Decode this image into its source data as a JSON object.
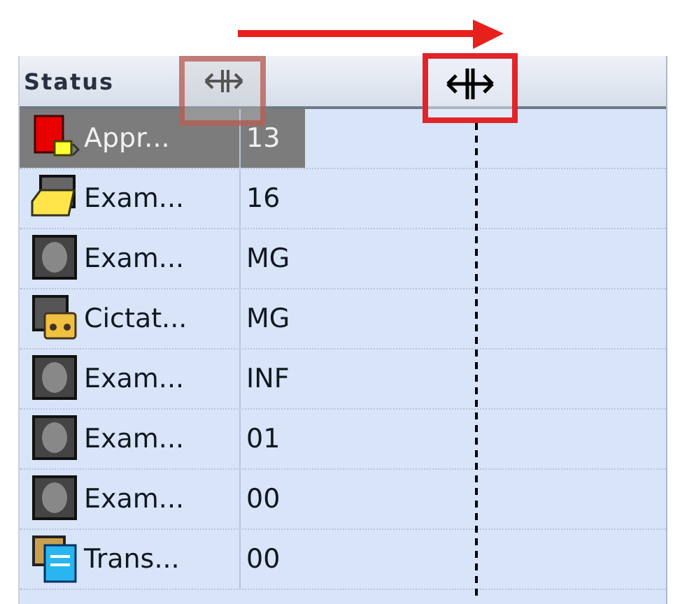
{
  "table": {
    "columns": [
      {
        "label": "Status"
      }
    ],
    "rows": [
      {
        "kind": "approval",
        "selected": true,
        "cells": [
          "Appr...",
          "13"
        ]
      },
      {
        "kind": "exam-folder",
        "selected": false,
        "cells": [
          "Exam...",
          "16"
        ]
      },
      {
        "kind": "exam",
        "selected": false,
        "cells": [
          "Exam...",
          "MG"
        ]
      },
      {
        "kind": "dictation",
        "selected": false,
        "cells": [
          "Cictat...",
          "MG"
        ]
      },
      {
        "kind": "exam",
        "selected": false,
        "cells": [
          "Exam...",
          "INF"
        ]
      },
      {
        "kind": "exam",
        "selected": false,
        "cells": [
          "Exam...",
          "01"
        ]
      },
      {
        "kind": "exam",
        "selected": false,
        "cells": [
          "Exam...",
          "00"
        ]
      },
      {
        "kind": "transcription",
        "selected": false,
        "cells": [
          "Trans...",
          "00"
        ]
      }
    ]
  }
}
